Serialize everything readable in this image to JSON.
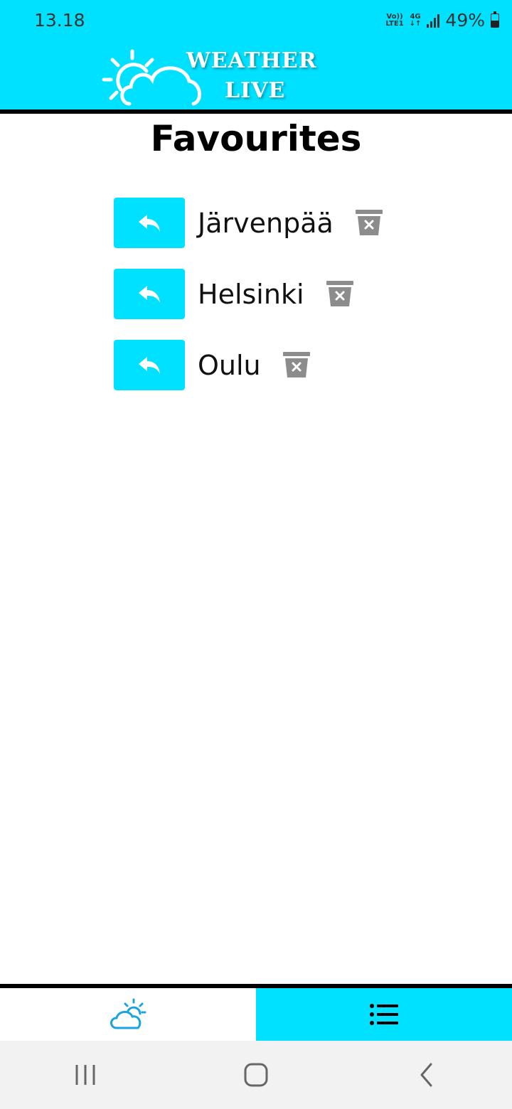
{
  "status": {
    "time": "13.18",
    "volte": "Vo))",
    "lte": "LTE1",
    "network": "4G",
    "battery": "49%"
  },
  "app": {
    "logo_line1": "WEATHER",
    "logo_line2": "LIVE",
    "accent_color": "#00e0ff"
  },
  "page": {
    "title": "Favourites"
  },
  "favourites": [
    {
      "name": "Järvenpää"
    },
    {
      "name": "Helsinki"
    },
    {
      "name": "Oulu"
    }
  ],
  "icons": {
    "open": "reply-arrow-icon",
    "delete": "trash-icon",
    "weather_tab": "cloud-sun-icon",
    "favourites_tab": "list-icon"
  }
}
